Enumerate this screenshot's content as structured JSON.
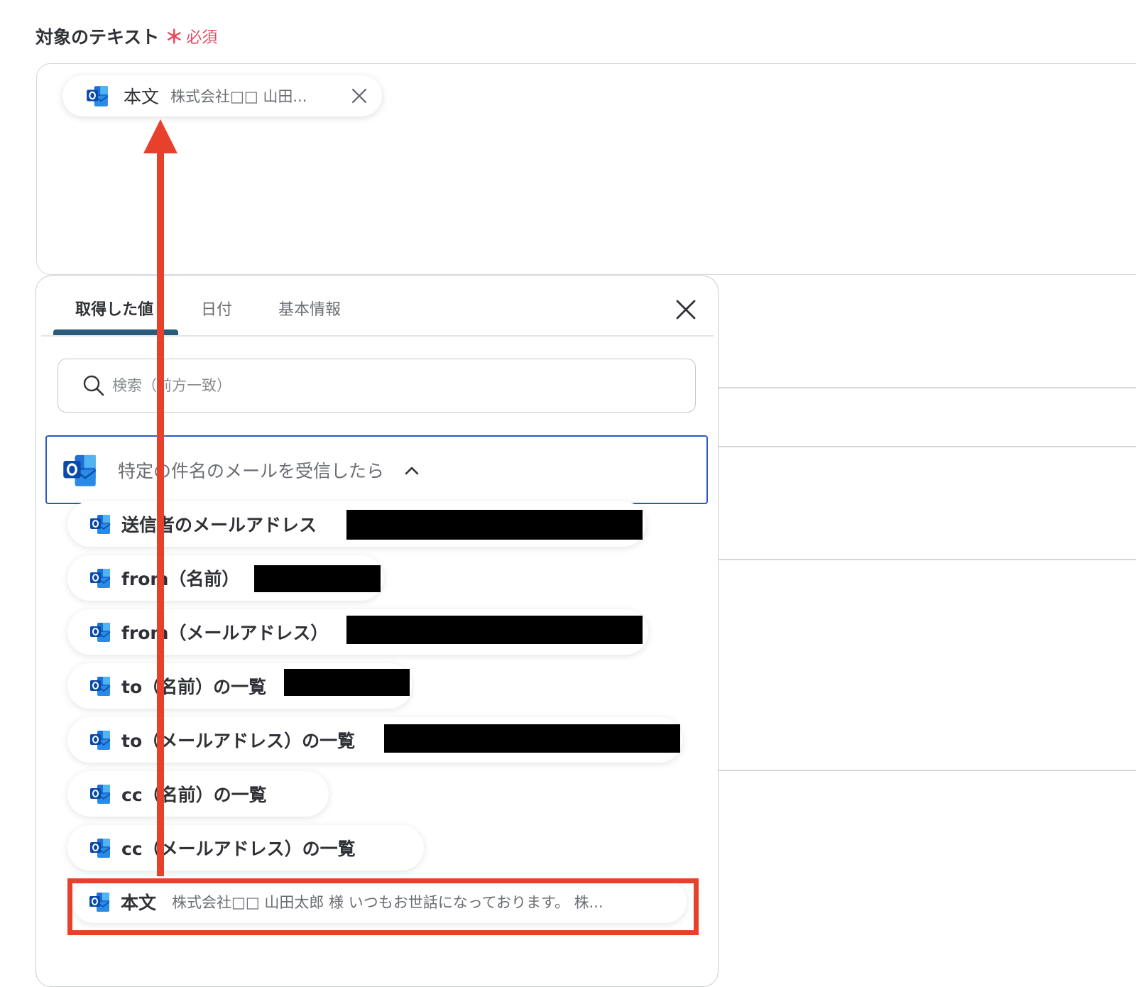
{
  "field": {
    "label": "対象のテキスト",
    "required_mark": "＊",
    "required_text": "必須"
  },
  "selected_chip": {
    "title": "本文",
    "preview": "株式会社□□ 山田...",
    "icon": "outlook-icon"
  },
  "panel": {
    "tabs": [
      {
        "label": "取得した値",
        "active": true
      },
      {
        "label": "日付",
        "active": false
      },
      {
        "label": "基本情報",
        "active": false
      }
    ],
    "search_placeholder": "検索（前方一致）",
    "group": {
      "title": "特定の件名のメールを受信したら",
      "expanded": true,
      "icon": "outlook-icon"
    },
    "items": [
      {
        "label": "送信者のメールアドレス",
        "redacted": true
      },
      {
        "label": "from（名前）",
        "redacted": true
      },
      {
        "label": "from（メールアドレス）",
        "redacted": true
      },
      {
        "label": "to（名前）の一覧",
        "redacted": true
      },
      {
        "label": "to（メールアドレス）の一覧",
        "redacted": true
      },
      {
        "label": "cc（名前）の一覧",
        "redacted": false
      },
      {
        "label": "cc（メールアドレス）の一覧",
        "redacted": false
      },
      {
        "label": "本文",
        "preview": "株式会社□□ 山田太郎 様 いつもお世話になっております。 株...",
        "highlighted": true
      }
    ]
  },
  "colors": {
    "accent_red": "#e8412b",
    "required_red": "#e84a5f",
    "focus_blue": "#2a58c9",
    "tab_underline": "#2a5a7a",
    "outlook_blue": "#0a64c8"
  }
}
